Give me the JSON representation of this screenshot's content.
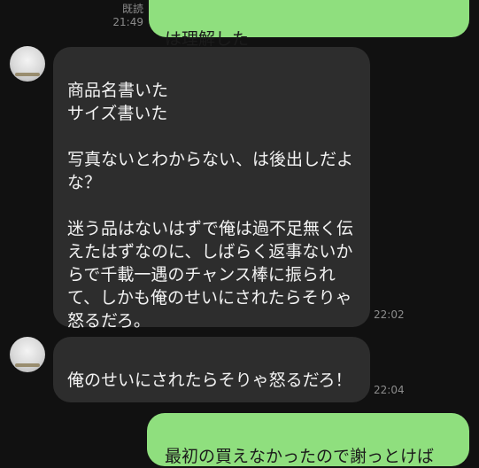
{
  "messages": [
    {
      "sender": "me",
      "text": "は理解した",
      "read_label": "既読",
      "time": "21:49"
    },
    {
      "sender": "other",
      "text": "商品名書いた\nサイズ書いた\n\n写真ないとわからない、は後出しだよな？\n\n迷う品はないはずで俺は過不足無く伝えたはずなのに、しばらく返事ないからで千載一遇のチャンス棒に振られて、しかも俺のせいにされたらそりゃ怒るだろ。",
      "time": "22:02"
    },
    {
      "sender": "other",
      "text": "俺のせいにされたらそりゃ怒るだろ！",
      "time": "22:04"
    },
    {
      "sender": "me",
      "text": "最初の買えなかったので謝っとけば"
    }
  ]
}
